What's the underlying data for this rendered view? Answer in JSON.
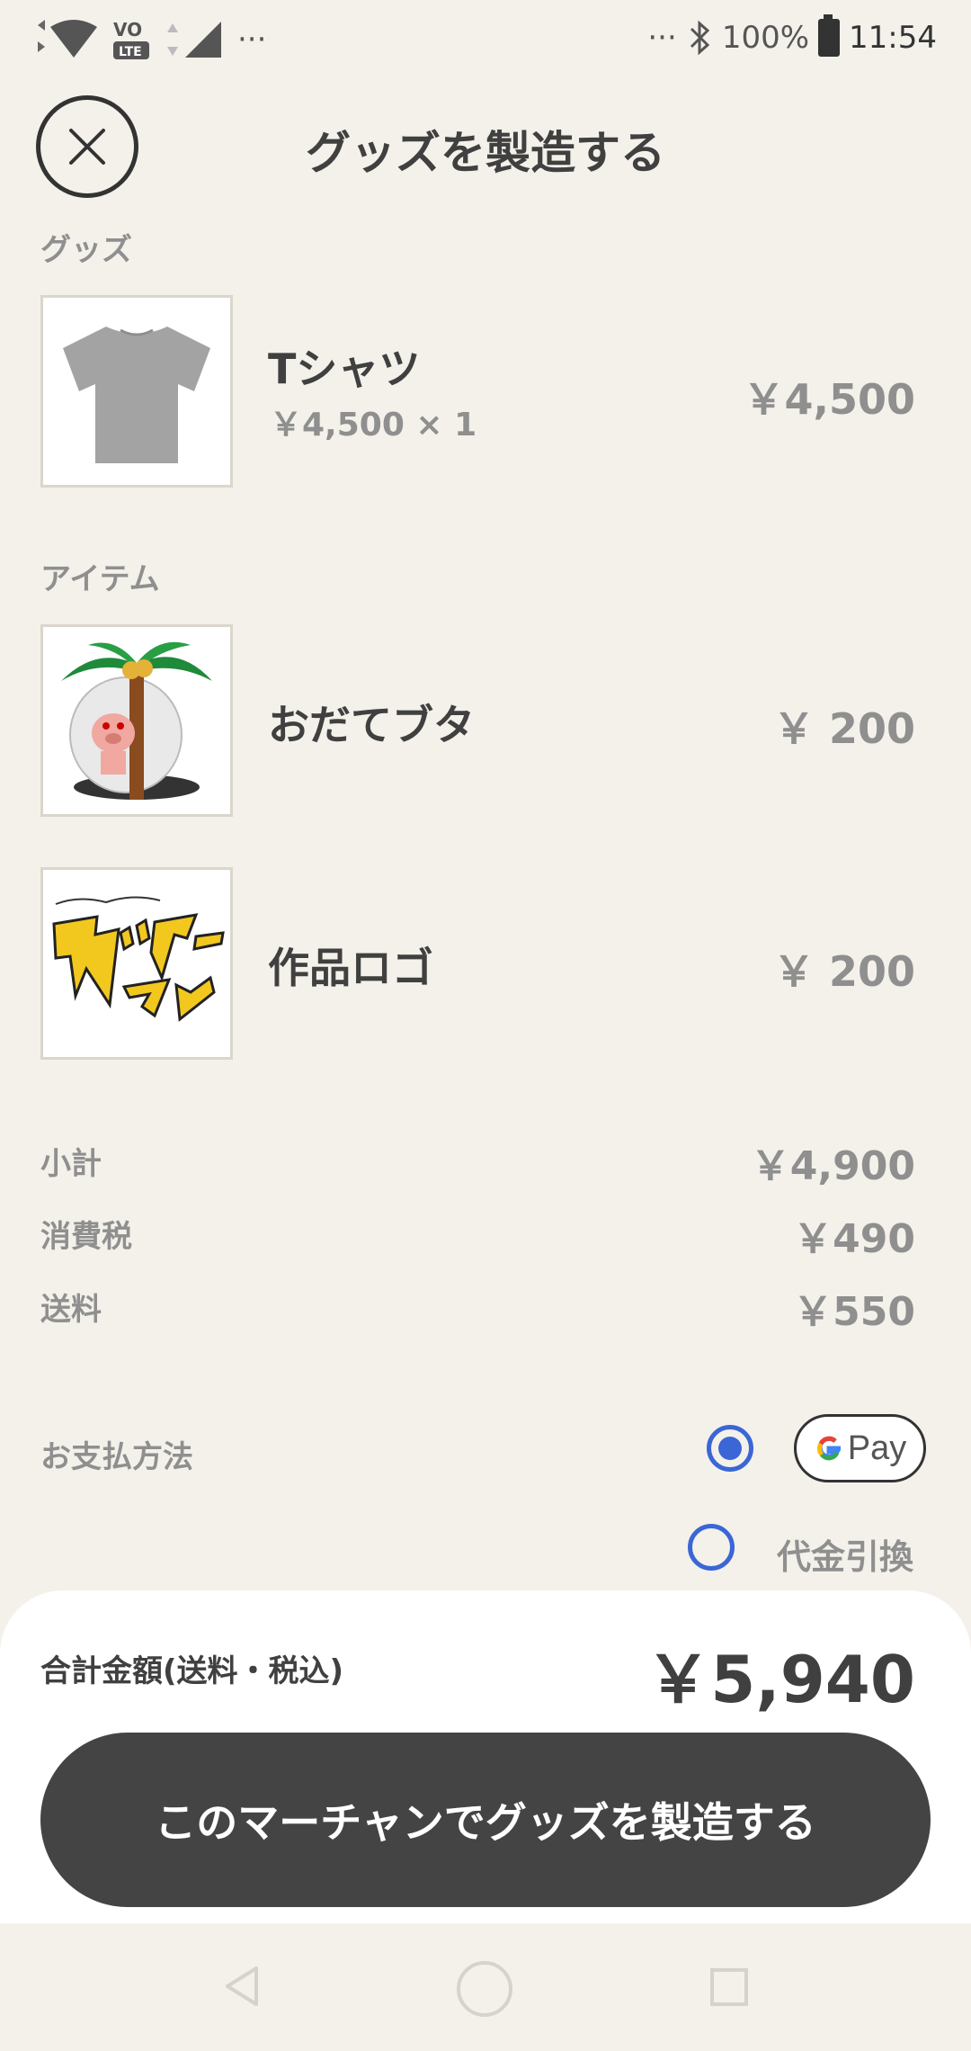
{
  "status_bar": {
    "time": "11:54",
    "battery": "100%",
    "more": "···",
    "left_more": "···"
  },
  "header": {
    "title": "グッズを製造する"
  },
  "goods_section": {
    "label": "グッズ",
    "item": {
      "name": "Tシャツ",
      "quantity_price": "￥4,500 × 1",
      "price": "￥4,500"
    }
  },
  "items_section": {
    "label": "アイテム",
    "items": [
      {
        "name": "おだてブタ",
        "price": "￥ 200"
      },
      {
        "name": "作品ロゴ",
        "price": "￥ 200"
      }
    ]
  },
  "summary": {
    "subtotal_label": "小計",
    "subtotal": "￥4,900",
    "tax_label": "消費税",
    "tax": "￥490",
    "shipping_label": "送料",
    "shipping": "￥550"
  },
  "payment": {
    "label": "お支払方法",
    "gpay_label": "Pay",
    "gpay_selected": true,
    "cod_label": "代金引換",
    "cod_selected": false
  },
  "total": {
    "label": "合計金額(送料・税込)",
    "value": "￥5,940"
  },
  "cta": {
    "label": "このマーチャンでグッズを製造する"
  },
  "colors": {
    "background": "#f3f1ea",
    "accent": "#3b66d6",
    "button": "#444444"
  }
}
